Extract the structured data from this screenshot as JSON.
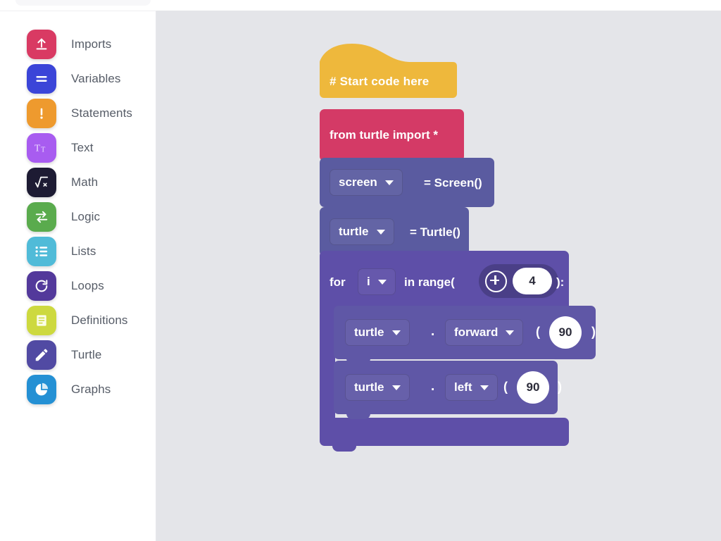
{
  "search": {
    "placeholder": ""
  },
  "sidebar": {
    "items": [
      {
        "label": "Imports",
        "icon": "upload-icon",
        "color": "#d93a63"
      },
      {
        "label": "Variables",
        "icon": "equals-icon",
        "color": "#3b45d8"
      },
      {
        "label": "Statements",
        "icon": "exclamation-icon",
        "color": "#ee9a2e"
      },
      {
        "label": "Text",
        "icon": "text-size-icon",
        "color": "#a85cf0"
      },
      {
        "label": "Math",
        "icon": "square-root-icon",
        "color": "#1d1b33"
      },
      {
        "label": "Logic",
        "icon": "swap-arrows-icon",
        "color": "#5aab4d"
      },
      {
        "label": "Lists",
        "icon": "list-icon",
        "color": "#50bbd8"
      },
      {
        "label": "Loops",
        "icon": "refresh-icon",
        "color": "#53399b"
      },
      {
        "label": "Definitions",
        "icon": "book-icon",
        "color": "#cdd93f"
      },
      {
        "label": "Turtle",
        "icon": "pencil-icon",
        "color": "#514aa3"
      },
      {
        "label": "Graphs",
        "icon": "pie-chart-icon",
        "color": "#2490d4"
      }
    ]
  },
  "workspace": {
    "background": "#e4e5e9",
    "blocks": {
      "hat": {
        "label": "# Start code here",
        "color": "#eeb83c"
      },
      "import": {
        "label": "from turtle import *",
        "color": "#d43a66"
      },
      "assign_screen": {
        "variable": "screen",
        "expression": "= Screen()",
        "color": "#5a5ba0"
      },
      "assign_turtle": {
        "variable": "turtle",
        "expression": "= Turtle()",
        "color": "#5a5ba0"
      },
      "for_loop": {
        "keyword": "for",
        "variable": "i",
        "range_label": "in range(",
        "count": "4",
        "close": "):",
        "color": "#5e4fa8",
        "input_color": "#4a3f87",
        "plus_icon": "plus-circle-icon"
      },
      "call_forward": {
        "object": "turtle",
        "dot": ".",
        "method": "forward",
        "open_paren": "(",
        "argument": "90",
        "close_paren": ")",
        "color": "#5f57a6"
      },
      "call_left": {
        "object": "turtle",
        "dot": ".",
        "method": "left",
        "open_paren": "(",
        "argument": "90",
        "close_paren": ")",
        "color": "#5f57a6"
      }
    }
  }
}
